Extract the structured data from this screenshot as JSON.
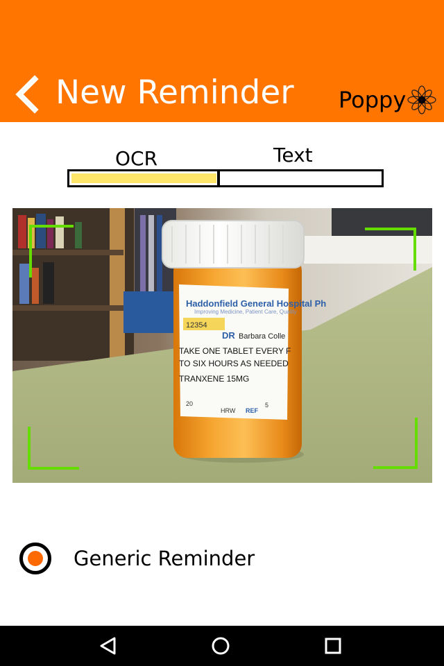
{
  "header": {
    "title": "New Reminder",
    "brand_name": "Poppy",
    "back_icon": "chevron-left-icon",
    "logo_icon": "poppy-flower-icon",
    "background_color": "#ff7500"
  },
  "progress": {
    "steps": [
      "OCR",
      "Text"
    ],
    "current_step": "OCR",
    "fill_fraction": 0.47,
    "fill_color": "#fde66a"
  },
  "camera": {
    "frame_color": "#66dd00",
    "bottle_label": {
      "hospital": "Haddonfield General Hospital Ph",
      "tagline": "Improving Medicine, Patient Care, Quality",
      "rx_number": "12354",
      "doctor_prefix": "DR",
      "doctor": "Barbara Colle",
      "instructions_1": "TAKE ONE TABLET EVERY F",
      "instructions_2": "TO SIX HOURS AS NEEDED",
      "drug": "TRANXENE 15MG",
      "qty": "20",
      "pharmacist": "HRW",
      "refills_label": "REF",
      "refills": "5"
    }
  },
  "options": {
    "generic_reminder_label": "Generic Reminder",
    "generic_reminder_selected": true,
    "accent_color": "#ff6a00"
  },
  "nav": {
    "back_icon": "triangle-back-icon",
    "home_icon": "circle-home-icon",
    "recents_icon": "square-recents-icon"
  }
}
